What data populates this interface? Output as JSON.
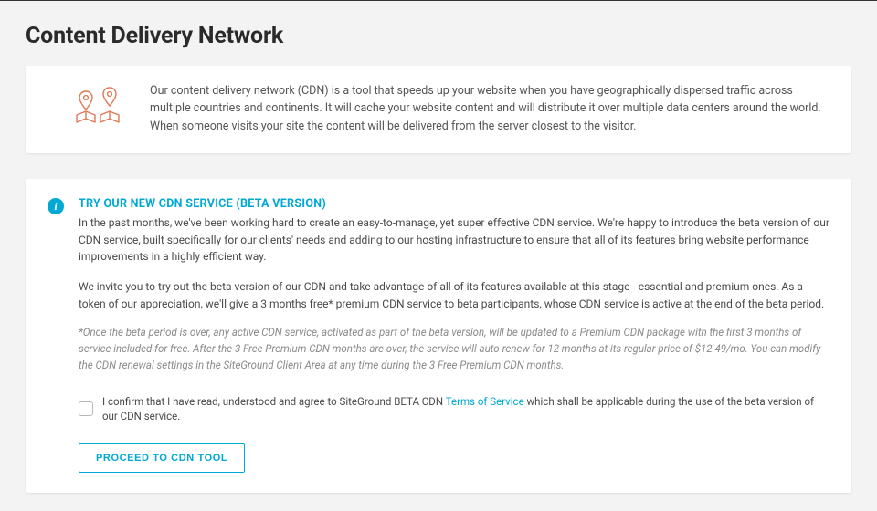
{
  "page": {
    "title": "Content Delivery Network"
  },
  "intro": {
    "text": "Our content delivery network (CDN) is a tool that speeds up your website when you have geographically dispersed traffic across multiple countries and continents. It will cache your website content and will distribute it over multiple data centers around the world. When someone visits your site the content will be delivered from the server closest to the visitor."
  },
  "beta": {
    "title": "TRY OUR NEW CDN SERVICE (BETA VERSION)",
    "para1": "In the past months, we've been working hard to create an easy-to-manage, yet super effective CDN service. We're happy to introduce the beta version of our CDN service, built specifically for our clients' needs and adding to our hosting infrastructure to ensure that all of its features bring website performance improvements in a highly efficient way.",
    "para2": "We invite you to try out the beta version of our CDN and take advantage of all of its features available at this stage - essential and premium ones. As a token of our appreciation, we'll give a 3 months free* premium CDN service to beta participants, whose CDN service is active at the end of the beta period.",
    "disclaimer": "*Once the beta period is over, any active CDN service, activated as part of the beta version, will be updated to a Premium CDN package with the first 3 months of service included for free. After the 3 Free Premium CDN months are over, the service will auto-renew for 12 months at its regular price of $12.49/mo. You can modify the CDN renewal settings in the SiteGround Client Area at any time during the 3 Free Premium CDN months.",
    "confirm_prefix": "I confirm that I have read, understood and agree to SiteGround BETA CDN ",
    "tos_link_text": "Terms of Service",
    "confirm_suffix": " which shall be applicable during the use of the beta version of our CDN service.",
    "proceed_label": "PROCEED TO CDN TOOL"
  },
  "icons": {
    "info_glyph": "i"
  },
  "colors": {
    "accent": "#00a8d6",
    "icon_stroke": "#e07856"
  }
}
